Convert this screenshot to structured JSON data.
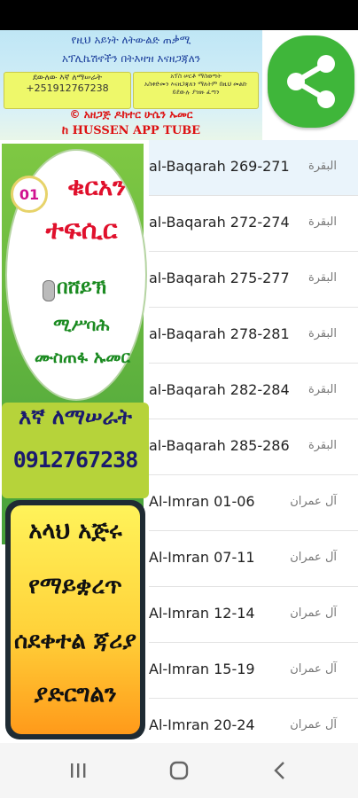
{
  "banner": {
    "line1": "የዚህ አይነት ለትውልድ ጠቃሚ",
    "line2": "አፕሊኬሽኖችን በትእዛዝ እናዘጋጃለን",
    "box_left_1": "ደውለው እኛ ለማሠራት",
    "box_left_2": "+251912767238",
    "box_right_1": "አፕስ ሠርቶ ማስወጣት",
    "box_right_2": "አስቀድመን እናዘጋጃለን ማለትም በዚህ መልኩ",
    "box_right_3": "ይደውሉ ያዝዙ ፈጣን",
    "line3": "© አዘጋጅ ዶክተር ሁሴን ኡመር",
    "line4": "ከ HUSSEN APP TUBE"
  },
  "side": {
    "badge": "01",
    "title1": "ቁርአን",
    "title2": "ተፍሲር",
    "by": "በሸይኽ",
    "name1": "ሚሥባሕ",
    "name2": "ሙስጠፋ ኡመር",
    "contact_label": "እኛ ለማሠራት",
    "phone": "0912767238",
    "dua1": "አላህ አጅሩ",
    "dua2": "የማይቋረጥ",
    "dua3": "ሰደቀተል ጃሪያ",
    "dua4": "ያድርግልን"
  },
  "list": [
    {
      "latin": "al-Baqarah 269-271",
      "arabic": "البقرة"
    },
    {
      "latin": "al-Baqarah 272-274",
      "arabic": "البقرة"
    },
    {
      "latin": "al-Baqarah 275-277",
      "arabic": "البقرة"
    },
    {
      "latin": "al-Baqarah 278-281",
      "arabic": "البقرة"
    },
    {
      "latin": "al-Baqarah 282-284",
      "arabic": "البقرة"
    },
    {
      "latin": "al-Baqarah 285-286",
      "arabic": "البقرة"
    },
    {
      "latin": "Al-Imran 01-06",
      "arabic": "آل عمران"
    },
    {
      "latin": "Al-Imran 07-11",
      "arabic": "آل عمران"
    },
    {
      "latin": "Al-Imran 12-14",
      "arabic": "آل عمران"
    },
    {
      "latin": "Al-Imran 15-19",
      "arabic": "آل عمران"
    },
    {
      "latin": "Al-Imran 20-24",
      "arabic": "آل عمران"
    }
  ],
  "icons": {
    "share": "share-icon",
    "nav_recent": "recent-apps-icon",
    "nav_home": "home-icon",
    "nav_back": "back-icon"
  },
  "colors": {
    "share_bg": "#3fb63a",
    "title_red": "#e0102c",
    "title_green": "#1a8a20",
    "banner_red": "#d11111"
  }
}
